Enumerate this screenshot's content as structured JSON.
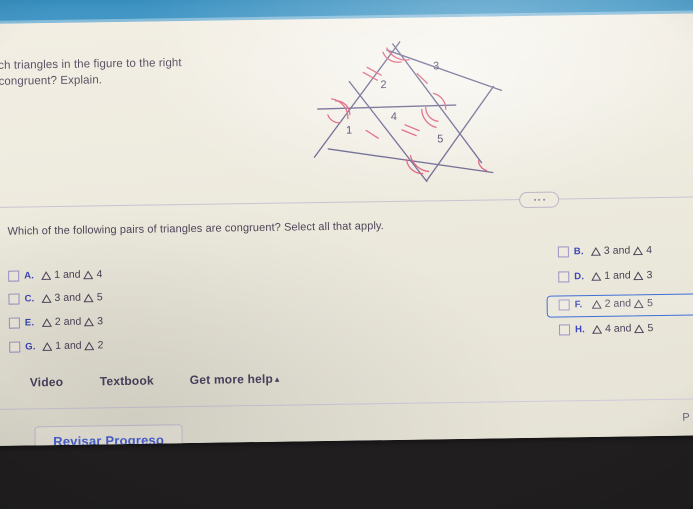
{
  "app": {
    "top_band_color": "#3f94c3",
    "page_background": "#eeeade",
    "bezel_color": "#201e1f"
  },
  "question": {
    "line1": "Which triangles in the figure to the right",
    "line2": "are congruent? Explain.",
    "sub_prompt": "Which of the following pairs of triangles are congruent? Select all that apply."
  },
  "figure": {
    "name": "congruent-triangles-diagram",
    "region_labels": [
      "1",
      "2",
      "3",
      "4",
      "5"
    ],
    "line_color": "#6f6a93",
    "mark_color": "#e0627f",
    "description": "Large triangle subdivided by midsegments into regions numbered 1 through 5, with tick marks and angle arcs"
  },
  "divider": {
    "dots_label": "..."
  },
  "options": {
    "left": [
      {
        "letter": "A.",
        "t1": "1",
        "conj": "and",
        "t2": "4",
        "checked": false
      },
      {
        "letter": "C.",
        "t1": "3",
        "conj": "and",
        "t2": "5",
        "checked": false
      },
      {
        "letter": "E.",
        "t1": "2",
        "conj": "and",
        "t2": "3",
        "checked": false
      },
      {
        "letter": "G.",
        "t1": "1",
        "conj": "and",
        "t2": "2",
        "checked": false
      }
    ],
    "right": [
      {
        "letter": "B.",
        "t1": "3",
        "conj": "and",
        "t2": "4",
        "checked": false
      },
      {
        "letter": "D.",
        "t1": "1",
        "conj": "and",
        "t2": "3",
        "checked": false
      },
      {
        "letter": "F.",
        "t1": "2",
        "conj": "and",
        "t2": "5",
        "checked": false,
        "focused": true
      },
      {
        "letter": "H.",
        "t1": "4",
        "conj": "and",
        "t2": "5",
        "checked": false
      }
    ],
    "focus_color": "#3f6fd8"
  },
  "help": {
    "video": "Video",
    "textbook": "Textbook",
    "more": "Get more help",
    "more_caret": "▴"
  },
  "footer": {
    "progress_button": "Revisar Progreso",
    "right_partial": "P"
  }
}
